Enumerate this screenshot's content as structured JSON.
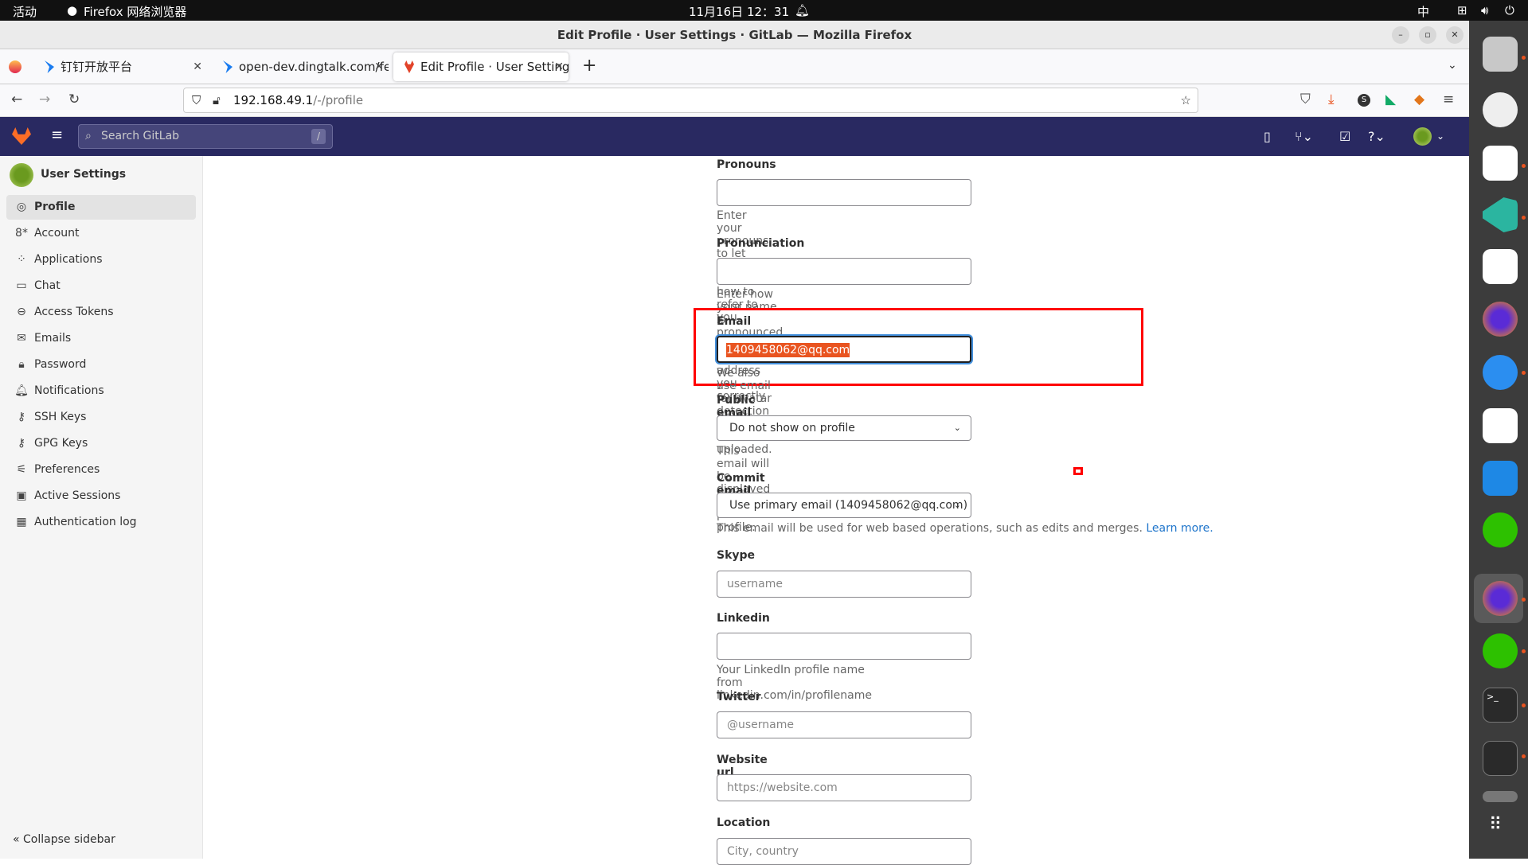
{
  "system": {
    "activities": "活动",
    "app_name": "Firefox 网络浏览器",
    "clock": "11月16日 12：31",
    "ime": "中"
  },
  "window": {
    "title": "Edit Profile · User Settings · GitLab — Mozilla Firefox",
    "min": "–",
    "restore": "▫",
    "close": "✕"
  },
  "tabs": [
    {
      "label": "钉钉开放平台"
    },
    {
      "label": "open-dev.dingtalk.com/fe"
    },
    {
      "label": "Edit Profile · User Settings"
    }
  ],
  "tab_close": "✕",
  "new_tab": "+",
  "url": {
    "host": "192.168.49.1",
    "path": "/-/profile"
  },
  "gitlab": {
    "search_placeholder": "Search GitLab",
    "search_shortcut": "/"
  },
  "sidebar": {
    "title": "User Settings",
    "items": [
      {
        "label": "Profile",
        "icon": "profile-icon",
        "glyph": "◎"
      },
      {
        "label": "Account",
        "icon": "account-icon",
        "glyph": "8*"
      },
      {
        "label": "Applications",
        "icon": "applications-icon",
        "glyph": "⁘"
      },
      {
        "label": "Chat",
        "icon": "chat-icon",
        "glyph": "▭"
      },
      {
        "label": "Access Tokens",
        "icon": "token-icon",
        "glyph": "⊖"
      },
      {
        "label": "Emails",
        "icon": "mail-icon",
        "glyph": "✉"
      },
      {
        "label": "Password",
        "icon": "lock-icon",
        "glyph": "🔒︎"
      },
      {
        "label": "Notifications",
        "icon": "bell-icon",
        "glyph": "🔔︎"
      },
      {
        "label": "SSH Keys",
        "icon": "key-icon",
        "glyph": "⚷"
      },
      {
        "label": "GPG Keys",
        "icon": "key-icon",
        "glyph": "⚷"
      },
      {
        "label": "Preferences",
        "icon": "preferences-icon",
        "glyph": "⚟"
      },
      {
        "label": "Active Sessions",
        "icon": "monitor-icon",
        "glyph": "▣"
      },
      {
        "label": "Authentication log",
        "icon": "log-icon",
        "glyph": "▦"
      }
    ],
    "collapse": "Collapse sidebar"
  },
  "form": {
    "pronouns": {
      "label": "Pronouns",
      "value": "",
      "help": "Enter your pronouns to let people know how to refer to you."
    },
    "pronunciation": {
      "label": "Pronunciation",
      "value": "",
      "help": "Enter how your name is pronounced to help people address you correctly."
    },
    "email": {
      "label": "Email",
      "value": "1409458062@qq.com",
      "help": "We also use email for avatar detection if no avatar is uploaded."
    },
    "public_email": {
      "label": "Public email",
      "selected": "Do not show on profile",
      "help": "This email will be displayed on your public profile."
    },
    "commit_email": {
      "label": "Commit email",
      "selected": "Use primary email (1409458062@qq.com)",
      "help": "This email will be used for web based operations, such as edits and merges.",
      "link": "Learn more."
    },
    "skype": {
      "label": "Skype",
      "placeholder": "username"
    },
    "linkedin": {
      "label": "Linkedin",
      "value": "",
      "help": "Your LinkedIn profile name from linkedin.com/in/profilename"
    },
    "twitter": {
      "label": "Twitter",
      "placeholder": "@username"
    },
    "website": {
      "label": "Website url",
      "placeholder": "https://website.com"
    },
    "location": {
      "label": "Location",
      "placeholder": "City, country"
    }
  },
  "colors": {
    "highlight": "#ff0000",
    "selection": "#e95420",
    "header": "#292961",
    "link": "#1f75cb"
  }
}
